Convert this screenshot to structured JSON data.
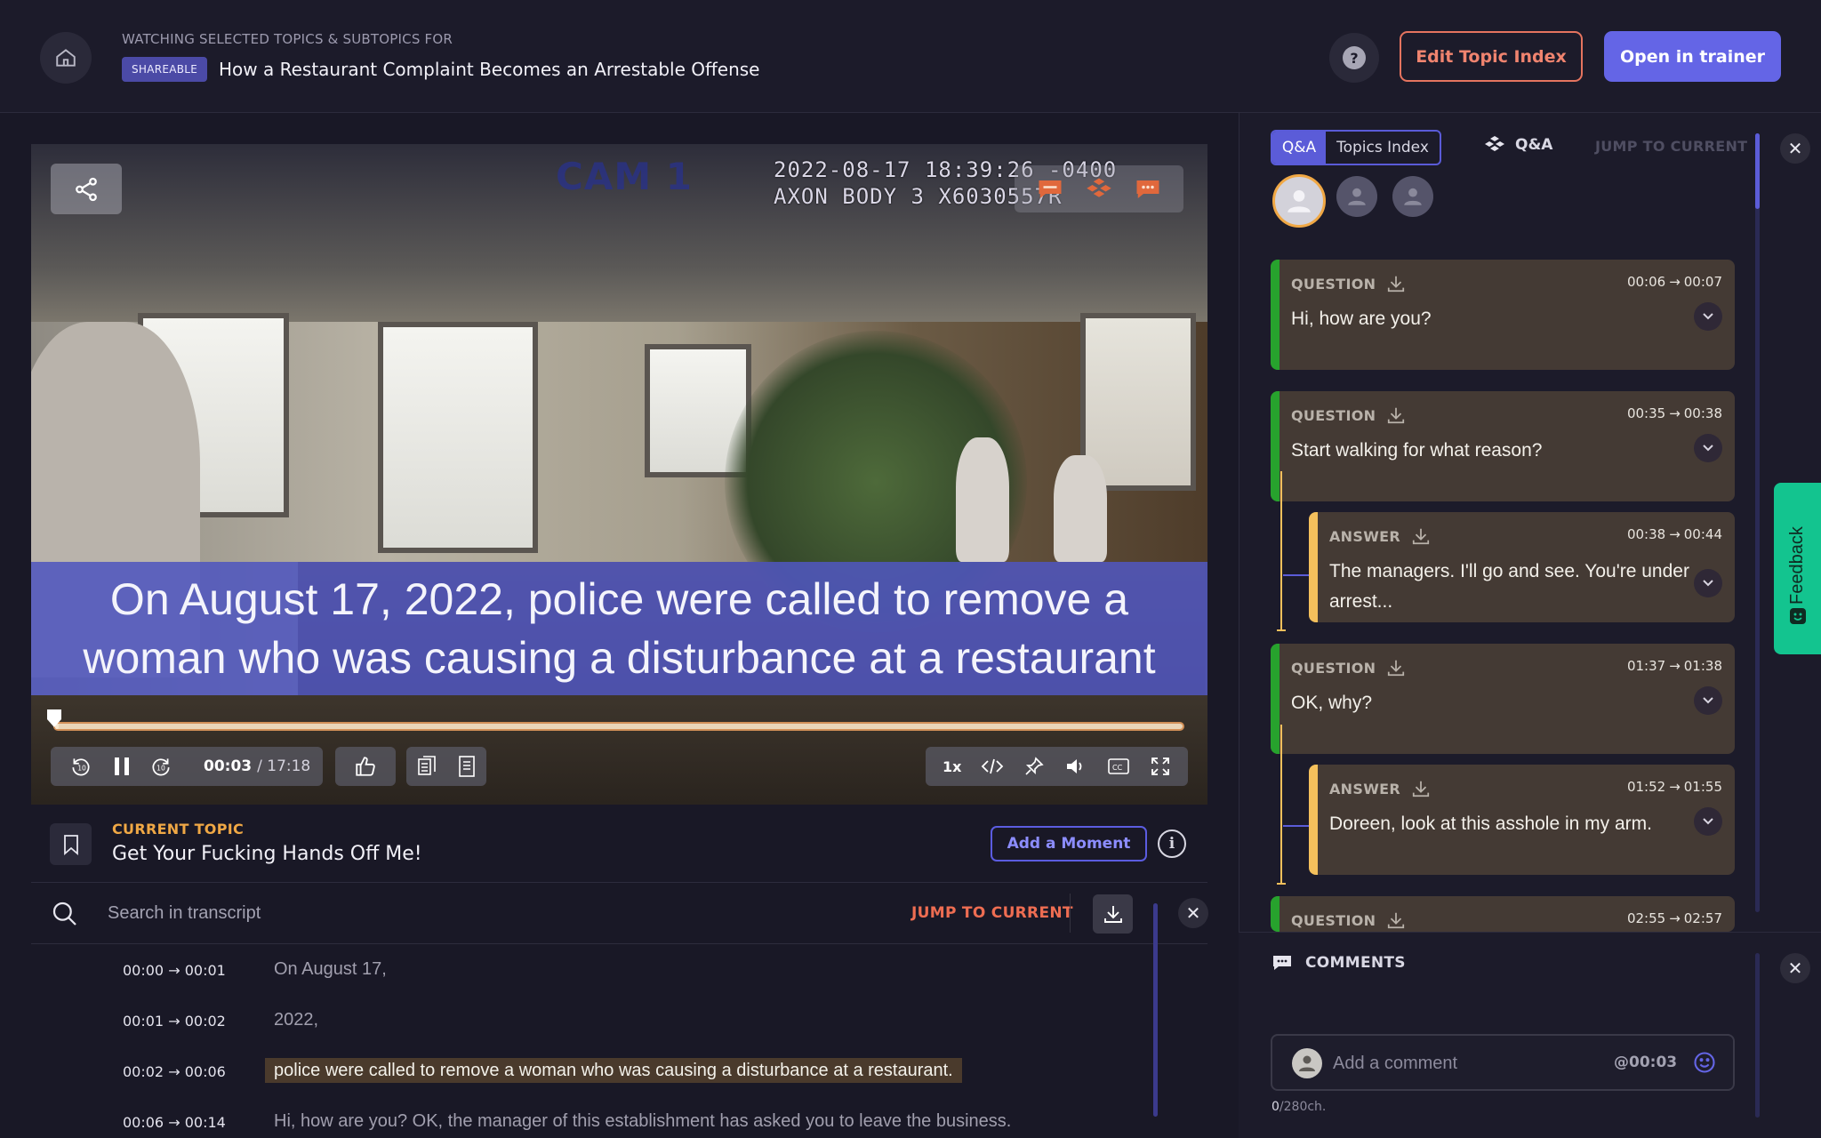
{
  "header": {
    "watching_label": "WATCHING SELECTED TOPICS & SUBTOPICS FOR",
    "badge": "SHAREABLE",
    "title": "How a Restaurant Complaint Becomes an Arrestable Offense",
    "edit_button": "Edit Topic Index",
    "open_trainer_button": "Open in trainer"
  },
  "video": {
    "cam_label": "CAM 1",
    "stamp_line1": "2022-08-17 18:39:26 -0400",
    "stamp_line2": "AXON BODY 3 X6030557R",
    "caption_line1": "On August 17, 2022, police were called to remove a",
    "caption_line2": "woman who was causing a disturbance at a restaurant",
    "progress_fraction": 0.003,
    "time_current": "00:03",
    "time_total": "/ 17:18",
    "speed": "1x"
  },
  "current_topic": {
    "label": "CURRENT TOPIC",
    "value": "Get Your Fucking Hands Off Me!",
    "add_moment": "Add a Moment"
  },
  "transcript": {
    "search_placeholder": "Search in transcript",
    "jump_current": "JUMP TO CURRENT",
    "rows": [
      {
        "start": "00:00",
        "end": "00:01",
        "text": "On August 17,",
        "active": false
      },
      {
        "start": "00:01",
        "end": "00:02",
        "text": "2022,",
        "active": false
      },
      {
        "start": "00:02",
        "end": "00:06",
        "text": "police were called to remove a woman who was causing a disturbance at a restaurant.",
        "active": true
      },
      {
        "start": "00:06",
        "end": "00:14",
        "text": "Hi, how are you? OK, the manager of this establishment has asked you to leave the business.",
        "active": false
      }
    ]
  },
  "panel": {
    "tab_qa": "Q&A",
    "tab_index": "Topics Index",
    "mode_label": "Q&A",
    "jump_current": "JUMP TO CURRENT",
    "cards": [
      {
        "kind": "QUESTION",
        "start": "00:06",
        "end": "00:07",
        "text": "Hi, how are you?"
      },
      {
        "kind": "QUESTION",
        "start": "00:35",
        "end": "00:38",
        "text": "Start walking for what reason?"
      },
      {
        "kind": "ANSWER",
        "start": "00:38",
        "end": "00:44",
        "text": "The managers. I'll go and see. You're under arrest..."
      },
      {
        "kind": "QUESTION",
        "start": "01:37",
        "end": "01:38",
        "text": "OK, why?"
      },
      {
        "kind": "ANSWER",
        "start": "01:52",
        "end": "01:55",
        "text": "Doreen, look at this asshole in my arm."
      },
      {
        "kind": "QUESTION",
        "start": "02:55",
        "end": "02:57",
        "text": ""
      }
    ]
  },
  "comments": {
    "title": "COMMENTS",
    "placeholder": "Add a comment",
    "timestamp": "@00:03",
    "char_count_current": "0",
    "char_count_suffix": "/280ch."
  },
  "feedback": {
    "label": "Feedback"
  },
  "colors": {
    "accent": "#6465e6",
    "orange": "#f0846f",
    "question_stripe": "#27a22d",
    "answer_stripe": "#f4c05c"
  }
}
